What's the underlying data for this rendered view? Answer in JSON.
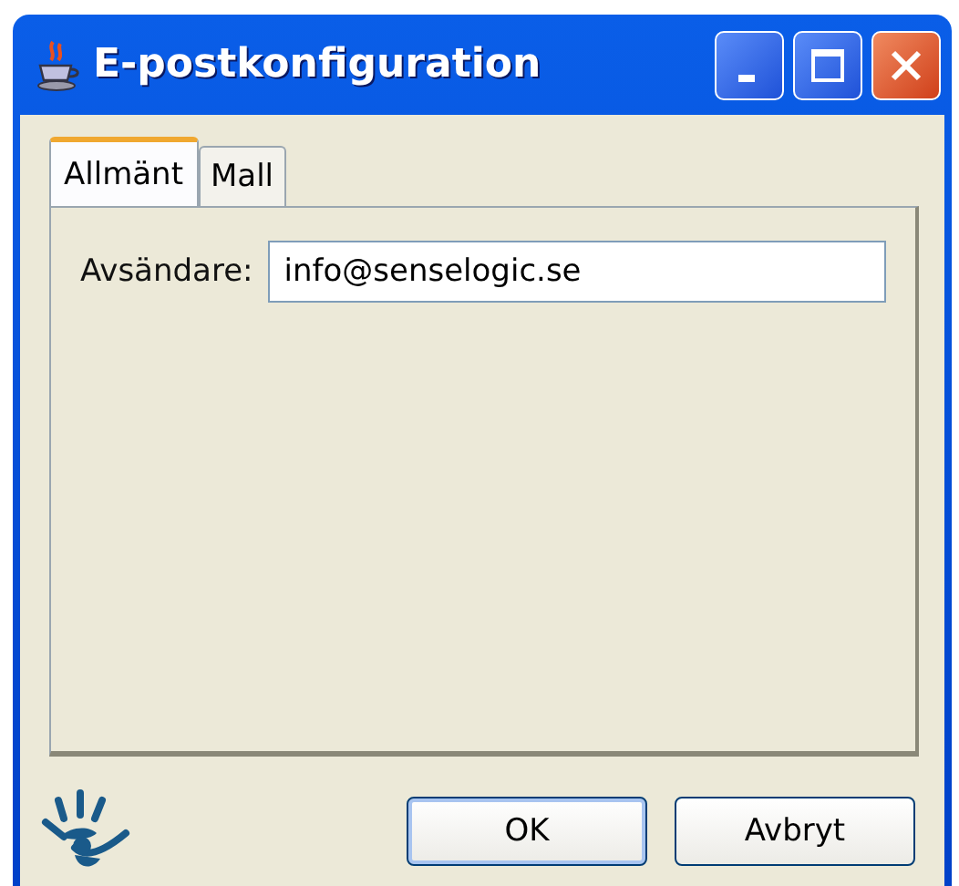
{
  "window": {
    "title": "E-postkonfiguration"
  },
  "tabs": [
    {
      "label": "Allmänt",
      "selected": true
    },
    {
      "label": "Mall",
      "selected": false
    }
  ],
  "sender": {
    "label": "Avsändare:",
    "value": "info@senselogic.se"
  },
  "buttons": [
    {
      "label": "OK",
      "default": true
    },
    {
      "label": "Avbryt",
      "default": false
    }
  ]
}
